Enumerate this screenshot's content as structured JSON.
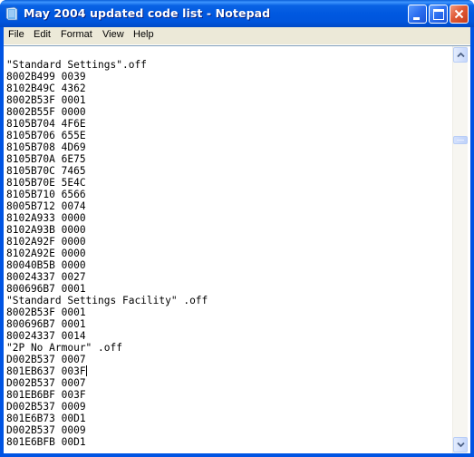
{
  "window": {
    "title": "May 2004 updated code list - Notepad",
    "app_icon": "notepad-icon",
    "controls": {
      "minimize": "minimize-icon",
      "maximize": "maximize-icon",
      "close": "close-icon"
    }
  },
  "menubar": {
    "items": [
      "File",
      "Edit",
      "Format",
      "View",
      "Help"
    ]
  },
  "editor": {
    "lines": [
      "",
      "\"Standard Settings\".off",
      "8002B499 0039",
      "8102B49C 4362",
      "8002B53F 0001",
      "8002B55F 0000",
      "8105B704 4F6E",
      "8105B706 655E",
      "8105B708 4D69",
      "8105B70A 6E75",
      "8105B70C 7465",
      "8105B70E 5E4C",
      "8105B710 6566",
      "8005B712 0074",
      "8102A933 0000",
      "8102A93B 0000",
      "8102A92F 0000",
      "8102A92E 0000",
      "80040B5B 0000",
      "80024337 0027",
      "800696B7 0001",
      "\"Standard Settings Facility\" .off",
      "8002B53F 0001",
      "800696B7 0001",
      "80024337 0014",
      "\"2P No Armour\" .off",
      "D002B537 0007",
      "801EB637 003F",
      "D002B537 0007",
      "801EB6BF 003F",
      "D002B537 0009",
      "801E6B73 00D1",
      "D002B537 0009",
      "801E6BFB 00D1"
    ],
    "caret_line": 27
  },
  "scrollbar": {
    "up_icon": "chevron-up-icon",
    "down_icon": "chevron-down-icon",
    "position_fraction": 0.2
  }
}
